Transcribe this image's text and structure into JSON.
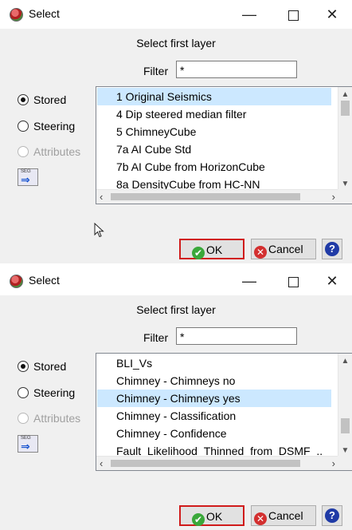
{
  "dialogs": [
    {
      "window_title": "Select",
      "heading": "Select  first layer",
      "filter_label": "Filter",
      "filter_value": "*",
      "radios": [
        {
          "label": "Stored",
          "checked": true,
          "disabled": false
        },
        {
          "label": "Steering",
          "checked": false,
          "disabled": false
        },
        {
          "label": "Attributes",
          "checked": false,
          "disabled": true
        }
      ],
      "seg_label": "SEG",
      "items": [
        {
          "label": "1 Original Seismics",
          "selected": true
        },
        {
          "label": "4 Dip steered median filter",
          "selected": false
        },
        {
          "label": "5 ChimneyCube",
          "selected": false
        },
        {
          "label": "7a AI Cube Std",
          "selected": false
        },
        {
          "label": "7b AI Cube from HorizonCube",
          "selected": false
        },
        {
          "label": "8a DensityCube from HC-NN",
          "selected": false
        }
      ],
      "vscroll_thumb": {
        "start": 0.0,
        "fraction": 0.2
      },
      "ok_label": "OK",
      "cancel_label": "Cancel",
      "help_label": "?"
    },
    {
      "window_title": "Select",
      "heading": "Select  first layer",
      "filter_label": "Filter",
      "filter_value": "*",
      "radios": [
        {
          "label": "Stored",
          "checked": true,
          "disabled": false
        },
        {
          "label": "Steering",
          "checked": false,
          "disabled": false
        },
        {
          "label": "Attributes",
          "checked": false,
          "disabled": true
        }
      ],
      "seg_label": "SEG",
      "items": [
        {
          "label": "BLI_Vs",
          "selected": false
        },
        {
          "label": "Chimney - Chimneys no",
          "selected": false
        },
        {
          "label": "Chimney - Chimneys yes",
          "selected": true
        },
        {
          "label": "Chimney - Classification",
          "selected": false
        },
        {
          "label": "Chimney - Confidence",
          "selected": false
        },
        {
          "label": "Fault_Likelihood_Thinned_from_DSMF_..",
          "selected": false
        }
      ],
      "vscroll_thumb": {
        "start": 0.67,
        "fraction": 0.2
      },
      "ok_label": "OK",
      "cancel_label": "Cancel",
      "help_label": "?"
    }
  ],
  "colors": {
    "selection": "#cce8ff",
    "ok_highlight_border": "#d01b1b",
    "ok_icon": "#3aa83a",
    "cancel_icon": "#d32f2f",
    "help_icon": "#1f3aa6"
  },
  "icons": [
    "app-icon",
    "seg-icon",
    "ok-check-icon",
    "cancel-x-icon",
    "help-icon",
    "mouse-cursor-icon"
  ]
}
